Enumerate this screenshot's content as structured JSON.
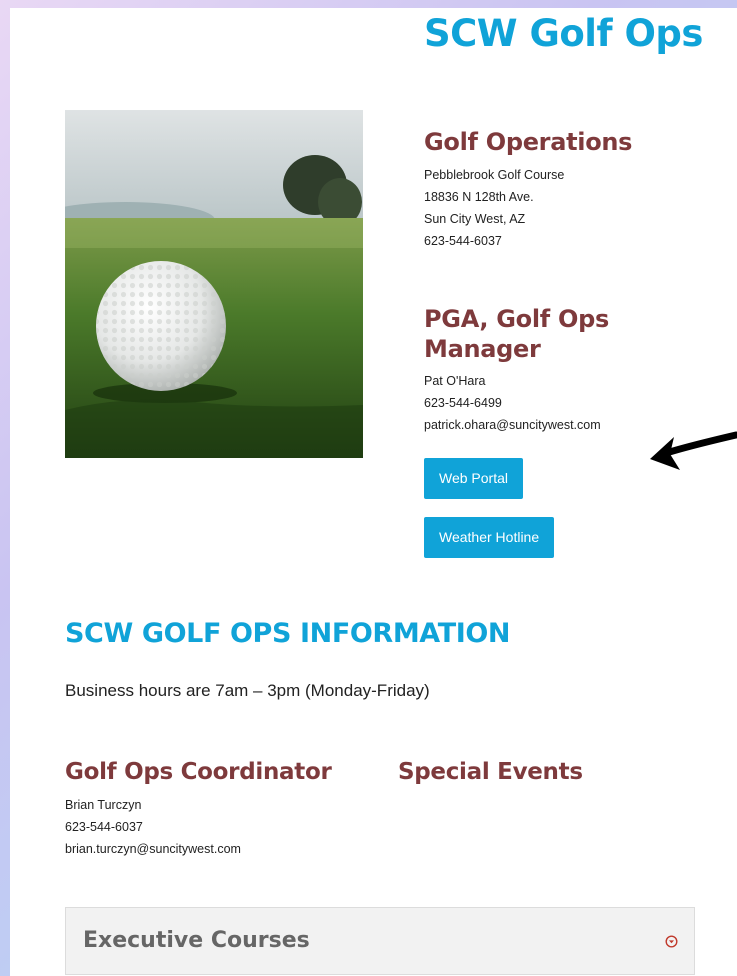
{
  "page": {
    "title": "SCW Golf Ops"
  },
  "golf_operations": {
    "heading": "Golf Operations",
    "lines": [
      "Pebblebrook Golf Course",
      "18836 N 128th Ave.",
      "Sun City West, AZ",
      "623-544-6037"
    ]
  },
  "manager": {
    "heading": "PGA, Golf Ops Manager",
    "lines": [
      "Pat O'Hara",
      "623-544-6499",
      "patrick.ohara@suncitywest.com"
    ]
  },
  "buttons": {
    "web_portal": "Web Portal",
    "weather_hotline": "Weather Hotline"
  },
  "info": {
    "title": "SCW GOLF OPS INFORMATION",
    "hours": "Business hours are 7am – 3pm (Monday-Friday)"
  },
  "coordinator": {
    "heading": "Golf Ops Coordinator",
    "lines": [
      "Brian Turczyn",
      "623-544-6037",
      "brian.turczyn@suncitywest.com"
    ]
  },
  "special_events": {
    "heading": "Special Events"
  },
  "accordion": {
    "label": "Executive Courses",
    "icon": "chevron-down-circle-icon"
  },
  "colors": {
    "accent": "#10a3d8",
    "heading": "#7e3a3c"
  }
}
